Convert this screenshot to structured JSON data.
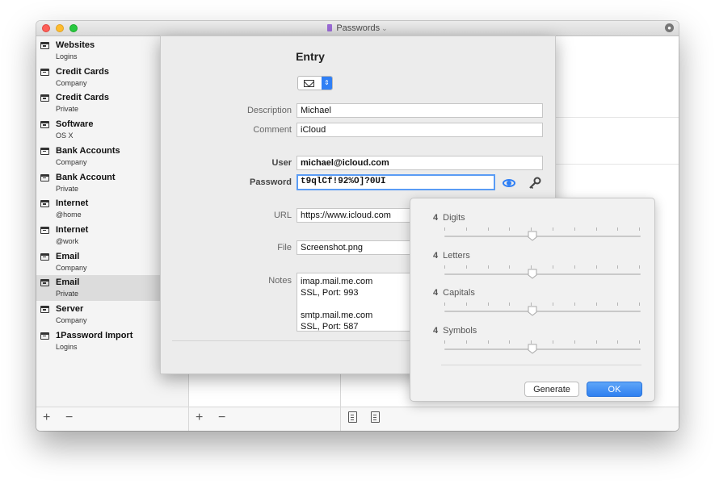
{
  "window": {
    "title": "Passwords",
    "title_chevron": "⌄"
  },
  "sidebar": {
    "items": [
      {
        "name": "Websites",
        "sub": "Logins"
      },
      {
        "name": "Credit Cards",
        "sub": "Company"
      },
      {
        "name": "Credit Cards",
        "sub": "Private"
      },
      {
        "name": "Software",
        "sub": "OS X"
      },
      {
        "name": "Bank Accounts",
        "sub": "Company"
      },
      {
        "name": "Bank Account",
        "sub": "Private"
      },
      {
        "name": "Internet",
        "sub": "@home"
      },
      {
        "name": "Internet",
        "sub": "@work"
      },
      {
        "name": "Email",
        "sub": "Company"
      },
      {
        "name": "Email",
        "sub": "Private",
        "selected": true
      },
      {
        "name": "Server",
        "sub": "Company"
      },
      {
        "name": "1Password Import",
        "sub": "Logins"
      }
    ],
    "add": "+",
    "remove": "−"
  },
  "list": {
    "add": "+",
    "remove": "−"
  },
  "entry": {
    "title": "Entry",
    "type_icon": "envelope-icon",
    "labels": {
      "description": "Description",
      "comment": "Comment",
      "user": "User",
      "password": "Password",
      "url": "URL",
      "file": "File",
      "notes": "Notes"
    },
    "values": {
      "description": "Michael",
      "comment": "iCloud",
      "user": "michael@icloud.com",
      "password": "t9qlCf!92%O]?0UI",
      "url": "https://www.icloud.com",
      "file": "Screenshot.png",
      "notes": [
        "imap.mail.me.com",
        "SSL, Port: 993",
        "",
        "smtp.mail.me.com",
        "SSL, Port: 587"
      ]
    }
  },
  "generator": {
    "sliders": [
      {
        "count": "4",
        "label": "Digits",
        "level": 0.45
      },
      {
        "count": "4",
        "label": "Letters",
        "level": 0.45
      },
      {
        "count": "4",
        "label": "Capitals",
        "level": 0.45
      },
      {
        "count": "4",
        "label": "Symbols",
        "level": 0.45
      }
    ],
    "generate_label": "Generate",
    "ok_label": "OK"
  },
  "colors": {
    "accent": "#2f7ff5",
    "selection": "#dcdcdc"
  }
}
